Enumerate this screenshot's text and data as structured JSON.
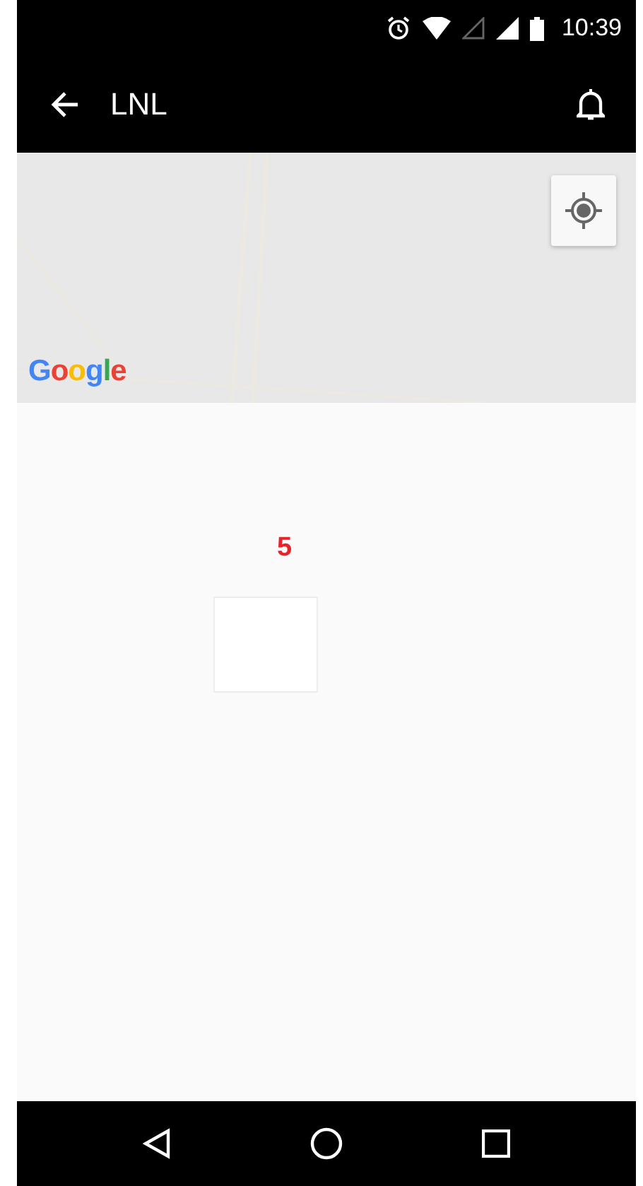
{
  "status_bar": {
    "time": "10:39"
  },
  "app_bar": {
    "title": "LNL"
  },
  "map": {
    "attribution": "Google"
  },
  "content": {
    "count": "5"
  }
}
